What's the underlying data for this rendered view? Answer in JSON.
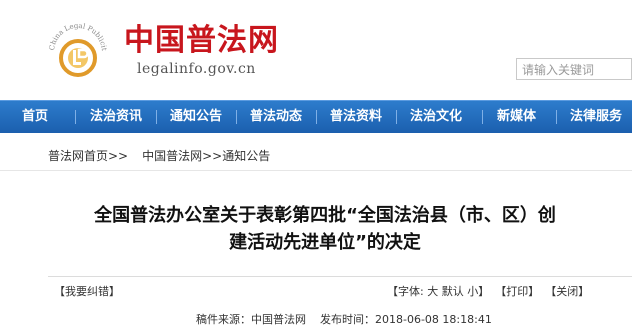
{
  "header": {
    "logo_arc_text": "China Legal Publicity",
    "site_title": "中国普法网",
    "site_url": "legalinfo.gov.cn",
    "search_placeholder": "请输入关键词"
  },
  "nav": {
    "items": [
      "首页",
      "法治资讯",
      "通知公告",
      "普法动态",
      "普法资料",
      "法治文化",
      "新媒体",
      "法律服务"
    ]
  },
  "breadcrumb": {
    "items": [
      "普法网首页>>",
      "中国普法网>>通知公告"
    ]
  },
  "article": {
    "title_line1": "全国普法办公室关于表彰第四批“全国法治县（市、区）创",
    "title_line2": "建活动先进单位”的决定",
    "correction_label": "【我要纠错】",
    "font_label": "【字体:",
    "font_large": "大",
    "font_default": "默认",
    "font_small": "小】",
    "print_label": "【打印】",
    "close_label": "【关闭】",
    "source": "稿件来源：中国普法网",
    "publish_time": "发布时间：2018-06-08 18:18:41"
  },
  "colors": {
    "brand_red": "#c8161d",
    "nav_blue": "#1f66b8",
    "logo_gold": "#e09a2a"
  }
}
